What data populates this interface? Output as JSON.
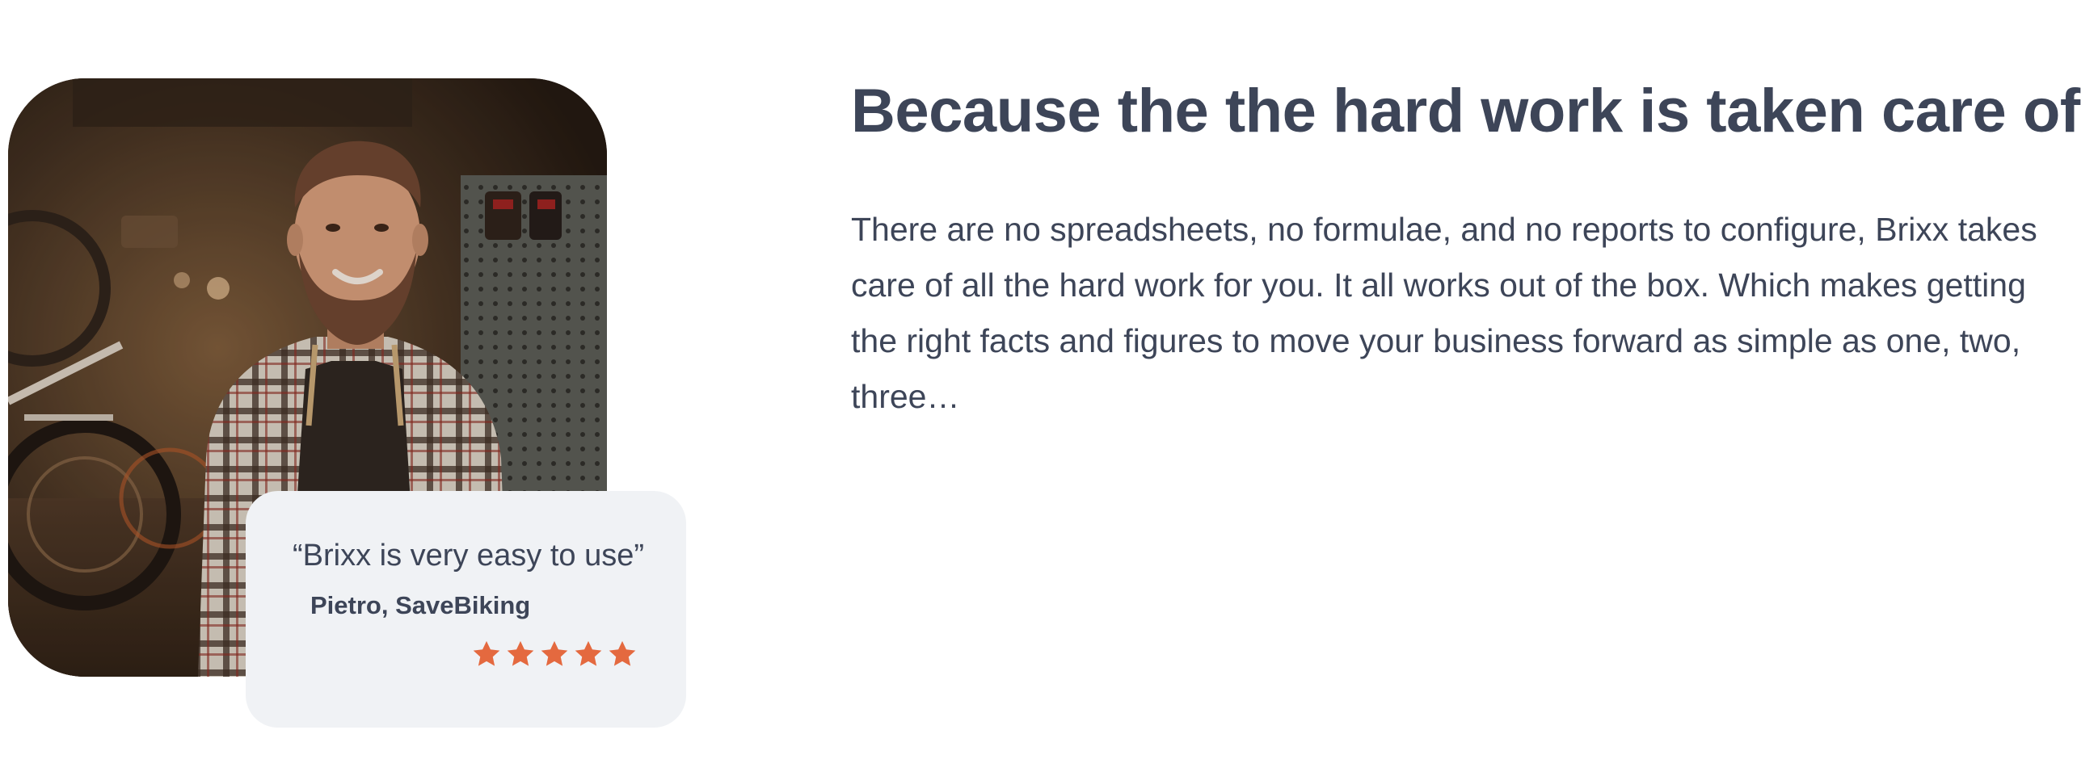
{
  "hero": {
    "headline": "Because the the hard work is taken care of",
    "body": "There are no spreadsheets, no formulae, and no reports to configure, Brixx takes care of all the hard work for you. It all works out of the box. Which makes getting the right facts and figures to move your business forward as simple as one, two, three…"
  },
  "testimonial": {
    "quote": "“Brixx is very easy to use”",
    "author": "Pietro, SaveBiking",
    "rating": 5,
    "rating_max": 5,
    "star_color": "#e4693f"
  },
  "colors": {
    "text": "#3d4558",
    "card_background": "#f0f2f5",
    "page_background": "#ffffff"
  }
}
